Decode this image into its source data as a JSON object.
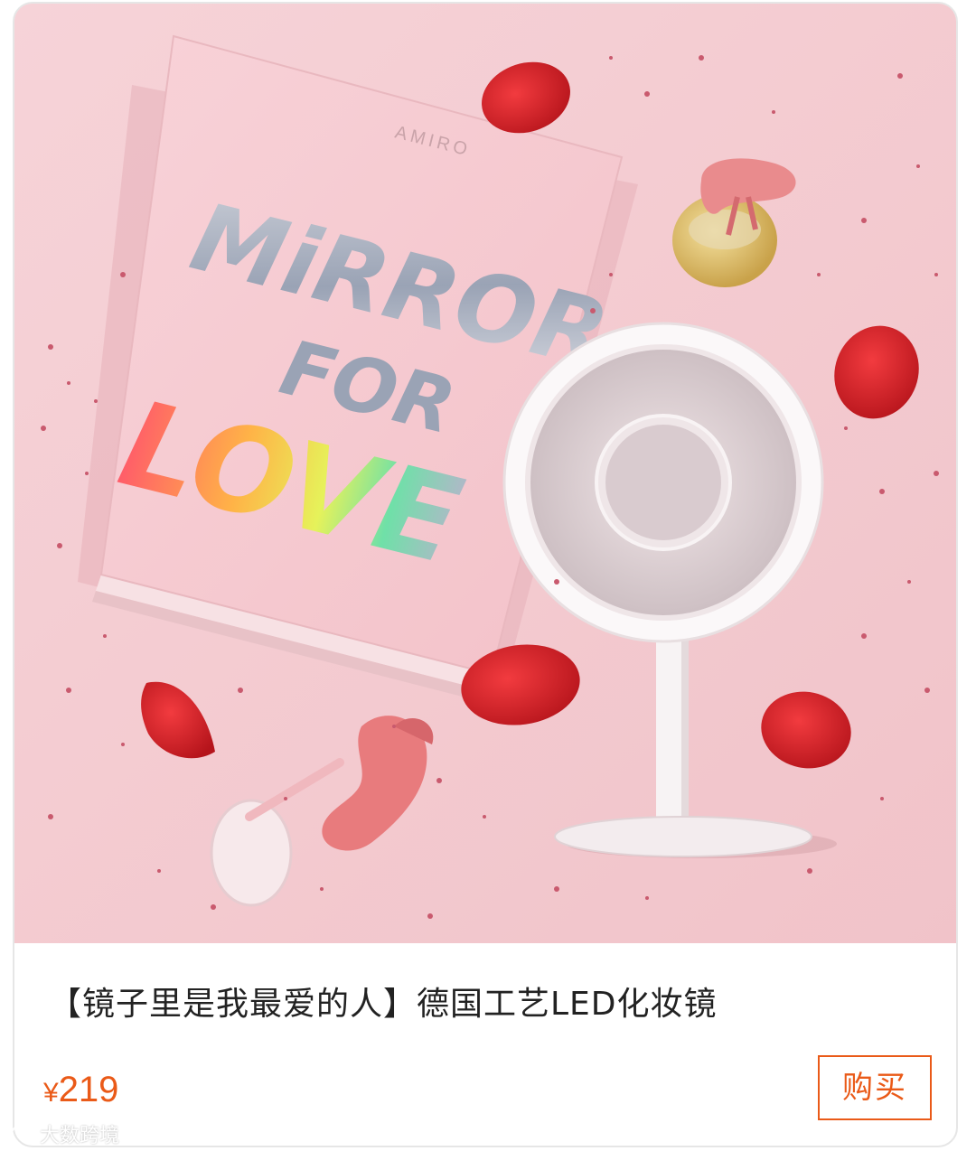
{
  "product": {
    "box_brand": "AMIRO",
    "box_slogan_line1": "MiRROR",
    "box_slogan_line2": "FOR",
    "box_slogan_line3": "LOVE",
    "title": "【镜子里是我最爱的人】德国工艺LED化妆镜",
    "currency": "¥",
    "price": "219",
    "buy_label": "购买"
  },
  "watermark": {
    "text": "大数跨境"
  },
  "colors": {
    "accent": "#ea5a18",
    "background_pink": "#f3c9cf",
    "petal_red": "#d81f26"
  }
}
